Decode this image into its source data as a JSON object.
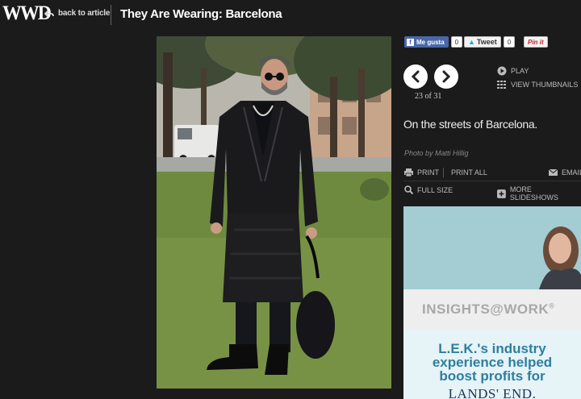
{
  "header": {
    "logo": "WWD",
    "back_label": "back to article",
    "title": "They Are Wearing: Barcelona"
  },
  "social": {
    "facebook_label": "Me gusta",
    "facebook_count": "0",
    "tweet_label": "Tweet",
    "tweet_count": "0",
    "pin_label": "Pin it"
  },
  "slideshow": {
    "counter": "23 of 31",
    "play_label": "PLAY",
    "thumbnails_label": "VIEW THUMBNAILS",
    "caption": "On the streets of Barcelona.",
    "credit": "Photo by Matti Hillig"
  },
  "actions": {
    "print": "PRINT",
    "print_all": "PRINT ALL",
    "email": "EMAIL",
    "full_size": "FULL SIZE",
    "more_slideshows": "MORE SLIDESHOWS"
  },
  "ad": {
    "headline": "INSIGHTS@WORK",
    "trademark": "®",
    "copy_lines": [
      "L.E.K.'s industry",
      "experience helped",
      "boost profits for"
    ],
    "brand": "LANDS' END."
  },
  "icons": {
    "back": "back-arrow-icon",
    "prev": "chevron-left-icon",
    "next": "chevron-right-icon",
    "play": "play-icon",
    "thumbs": "grid-icon",
    "print": "printer-icon",
    "email": "envelope-icon",
    "zoom": "magnifier-icon",
    "plus": "plus-icon"
  },
  "colors": {
    "background": "#1b1b1b",
    "facebook": "#4a67a8",
    "twitter": "#2aa3ef",
    "pinterest": "#cb2027",
    "ad_accent": "#2d7fa0"
  }
}
